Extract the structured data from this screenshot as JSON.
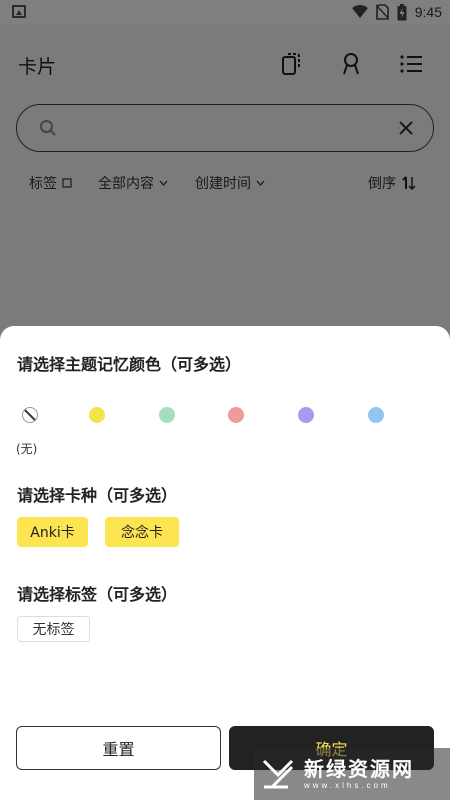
{
  "status_bar": {
    "time": "9:45"
  },
  "app": {
    "title": "卡片"
  },
  "search": {
    "value": "",
    "placeholder": ""
  },
  "filters": {
    "tag": "标签",
    "content": "全部内容",
    "created": "创建时间",
    "order": "倒序"
  },
  "sheet": {
    "color_title": "请选择主题记忆颜色（可多选）",
    "colors": [
      {
        "name": "none",
        "hex": "#ffffff"
      },
      {
        "name": "yellow",
        "hex": "#f5e34a"
      },
      {
        "name": "green",
        "hex": "#a6dcc0"
      },
      {
        "name": "red",
        "hex": "#f19a9a"
      },
      {
        "name": "purple",
        "hex": "#a89af0"
      },
      {
        "name": "blue",
        "hex": "#92c6f2"
      }
    ],
    "none_label": "(无)",
    "card_type_title": "请选择卡种（可多选）",
    "card_types": [
      "Anki卡",
      "念念卡"
    ],
    "tag_title": "请选择标签（可多选）",
    "tags": [
      "无标签"
    ],
    "reset_label": "重置",
    "confirm_label": "确定"
  },
  "watermark": {
    "text": "新绿资源网",
    "sub": "www.xlhs.com"
  },
  "theme": {
    "accent": "#fde552",
    "dark": "#222222"
  }
}
